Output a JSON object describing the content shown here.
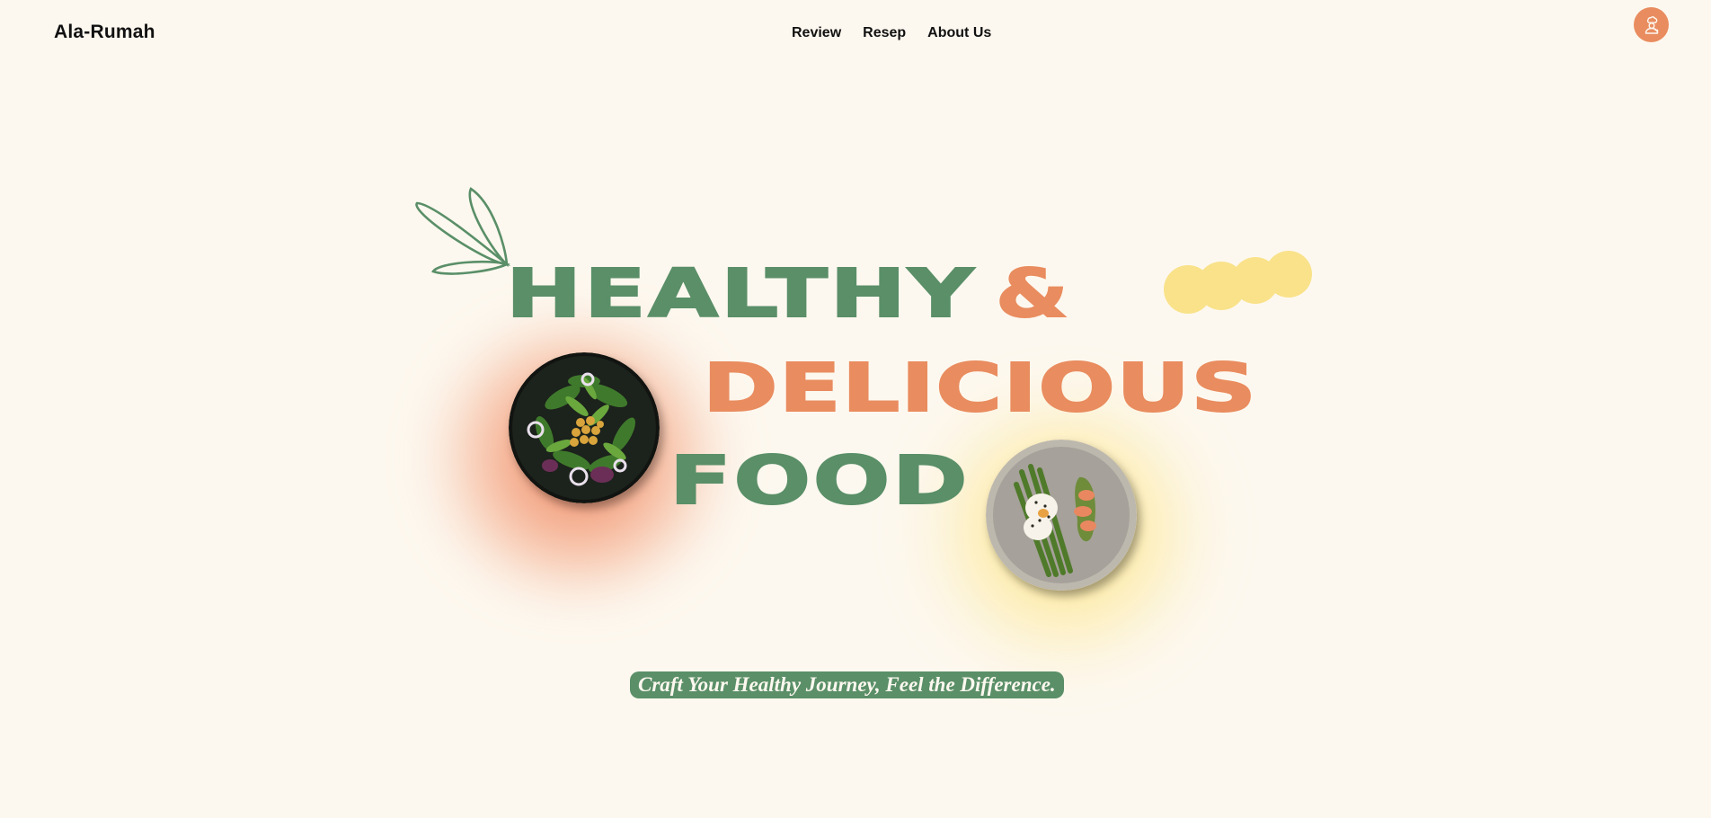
{
  "header": {
    "brand": "Ala-Rumah",
    "nav": [
      {
        "label": "Review"
      },
      {
        "label": "Resep"
      },
      {
        "label": "About Us"
      }
    ],
    "avatar_icon": "chef-icon"
  },
  "hero": {
    "line1_word": "HEALTHY",
    "line1_symbol": "&",
    "line2_word": "DELICIOUS",
    "line3_word": "FOOD",
    "tagline": "Craft Your Healthy Journey, Feel the Difference.",
    "images": [
      "salad-bowl-image",
      "asparagus-plate-image"
    ],
    "decorations": [
      "leaf-doodle",
      "cloud-shape"
    ]
  },
  "colors": {
    "background": "#fdf8ef",
    "green": "#5a8f68",
    "orange": "#e98c5f",
    "yellow": "#f9e28a",
    "text": "#111111"
  }
}
